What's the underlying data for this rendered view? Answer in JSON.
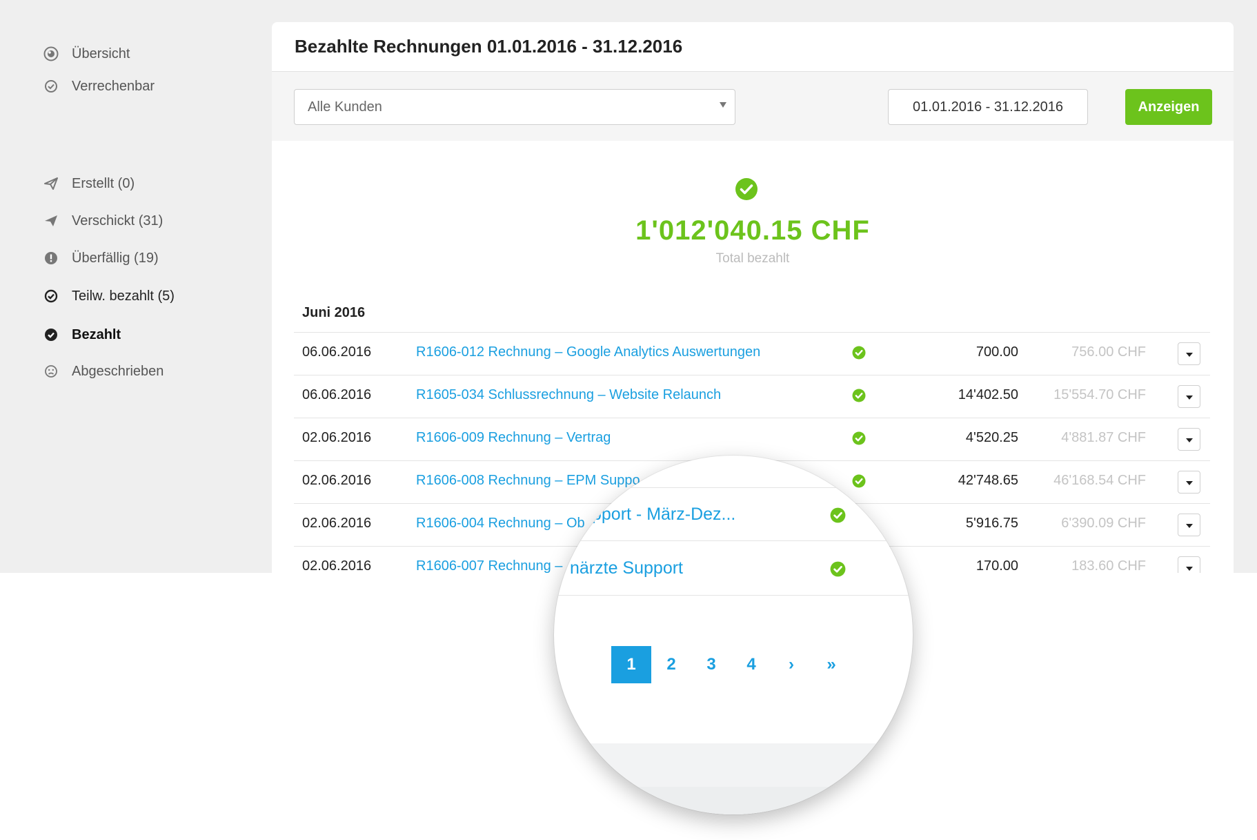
{
  "sidebar": {
    "items": [
      {
        "label": "Übersicht"
      },
      {
        "label": "Verrechenbar"
      },
      {
        "label": "Erstellt (0)"
      },
      {
        "label": "Verschickt (31)"
      },
      {
        "label": "Überfällig (19)"
      },
      {
        "label": "Teilw. bezahlt (5)"
      },
      {
        "label": "Bezahlt"
      },
      {
        "label": "Abgeschrieben"
      }
    ]
  },
  "main": {
    "title": "Bezahlte Rechnungen 01.01.2016 - 31.12.2016",
    "filter": {
      "customer_select": "Alle Kunden",
      "date_range": "01.01.2016 - 31.12.2016",
      "show_button": "Anzeigen"
    },
    "summary": {
      "total": "1'012'040.15 CHF",
      "label": "Total bezahlt"
    },
    "month": "Juni 2016",
    "rows": [
      {
        "date": "06.06.2016",
        "title": "R1606-012 Rechnung – Google Analytics Auswertungen",
        "paid": "700.00",
        "total": "756.00 CHF"
      },
      {
        "date": "06.06.2016",
        "title": "R1605-034 Schlussrechnung – Website Relaunch",
        "paid": "14'402.50",
        "total": "15'554.70 CHF"
      },
      {
        "date": "02.06.2016",
        "title": "R1606-009 Rechnung – Vertrag",
        "paid": "4'520.25",
        "total": "4'881.87 CHF"
      },
      {
        "date": "02.06.2016",
        "title": "R1606-008 Rechnung – EPM Suppo",
        "paid": "42'748.65",
        "total": "46'168.54 CHF"
      },
      {
        "date": "02.06.2016",
        "title": "R1606-004 Rechnung – Ob",
        "paid": "5'916.75",
        "total": "6'390.09 CHF"
      },
      {
        "date": "02.06.2016",
        "title": "R1606-007 Rechnung –",
        "paid": "170.00",
        "total": "183.60 CHF"
      }
    ]
  },
  "magnifier": {
    "rows": [
      {
        "text": "pport - März-Dez..."
      },
      {
        "text": "närzte Support"
      }
    ],
    "pagination": {
      "pages": [
        "1",
        "2",
        "3",
        "4"
      ],
      "next": "›",
      "last": "»",
      "active": "1"
    }
  },
  "colors": {
    "accent_green": "#6cc31c",
    "link_blue": "#1a9fe0",
    "app_background": "#efefef"
  }
}
